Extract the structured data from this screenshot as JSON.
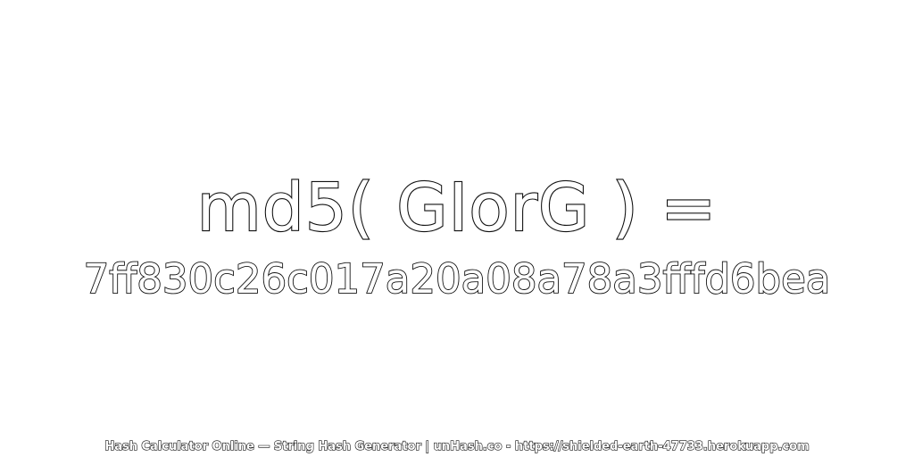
{
  "main": {
    "expression": "md5( GIorG ) =",
    "hash_value": "7ff830c26c017a20a08a78a3fffd6bea"
  },
  "footer": {
    "text": "Hash Calculator Online — String Hash Generator | unHash.co - https://shielded-earth-47733.herokuapp.com"
  },
  "colors": {
    "background": "#ffffff",
    "text_fill": "#ffffff",
    "text_outline": "#111111"
  }
}
